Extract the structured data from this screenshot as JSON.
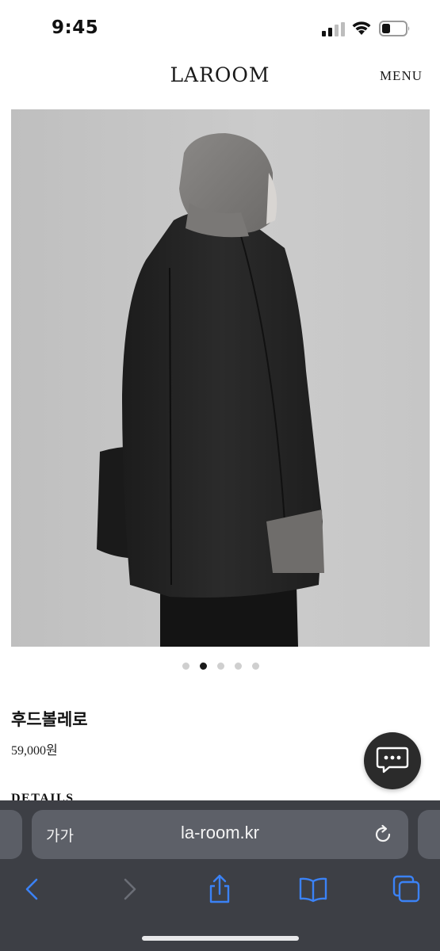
{
  "status_bar": {
    "time": "9:45",
    "icons": [
      "cellular-signal-icon",
      "wifi-icon",
      "battery-icon"
    ]
  },
  "header": {
    "logo": "LAROOM",
    "menu_label": "MENU"
  },
  "product": {
    "image_alt": "hood-bolero-coat-photo",
    "carousel": {
      "total": 5,
      "active_index": 1
    },
    "name": "후드볼레로",
    "price": "59,000원",
    "details_heading": "DETAILS"
  },
  "chat": {
    "icon": "chat-bubble-icon"
  },
  "browser": {
    "text_size_label": "가가",
    "url": "la-room.kr",
    "toolbar_icons": [
      "back-icon",
      "forward-icon",
      "share-icon",
      "bookmarks-icon",
      "tabs-icon"
    ]
  },
  "colors": {
    "accent_dark": "#1a1a1a",
    "browser_chrome": "#3d3f45",
    "safari_blue": "#3b82f6"
  }
}
